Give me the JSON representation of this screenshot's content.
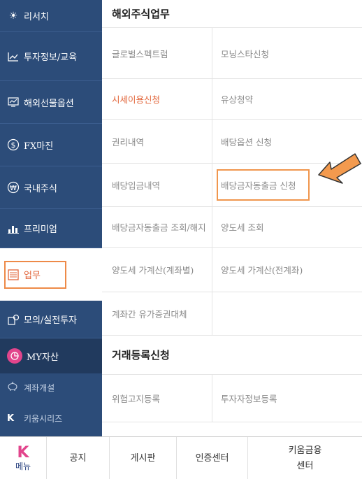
{
  "sidebar": {
    "items": [
      {
        "label": "리서치",
        "icon": "☀"
      },
      {
        "label": "투자정보/교육",
        "icon": "⌁"
      },
      {
        "label": "해외선물옵션",
        "icon": "▭"
      },
      {
        "label": "FX마진",
        "icon": "$"
      },
      {
        "label": "국내주식",
        "icon": "₩"
      },
      {
        "label": "프리미엄",
        "icon": "▮"
      },
      {
        "label": "업무",
        "icon": "☰"
      },
      {
        "label": "모의/실전투자",
        "icon": "⬚"
      },
      {
        "label": "MY자산",
        "icon": "◔"
      }
    ],
    "sub_items": [
      {
        "label": "계좌개설",
        "icon": "✎"
      },
      {
        "label": "키움시리즈",
        "icon": "K"
      }
    ]
  },
  "content": {
    "section1_title": "해외주식업무",
    "rows": [
      {
        "left": "글로벌스펙트럼",
        "right": "모닝스타신청"
      },
      {
        "left": "시세이용신청",
        "right": "유상청약"
      },
      {
        "left": "권리내역",
        "right": "배당옵션 신청"
      },
      {
        "left": "배당입금내역",
        "right": "배당금자동출금 신청"
      },
      {
        "left": "배당금자동출금 조회/해지",
        "right": "양도세 조회"
      },
      {
        "left": "양도세 가계산(계좌별)",
        "right": "양도세 가계산(전계좌)"
      },
      {
        "left": "계좌간 유가증권대체",
        "right": ""
      }
    ],
    "section2_title": "거래등록신청",
    "rows2": [
      {
        "left": "위험고지등록",
        "right": "투자자정보등록"
      }
    ]
  },
  "bottom": {
    "menu_logo": "K",
    "menu_label": "메뉴",
    "tabs": [
      "공지",
      "게시판",
      "인증센터",
      "키움금융\n센터"
    ]
  },
  "colors": {
    "sidebar": "#2c4c79",
    "accent": "#e2653a",
    "highlight": "#f0964d"
  }
}
